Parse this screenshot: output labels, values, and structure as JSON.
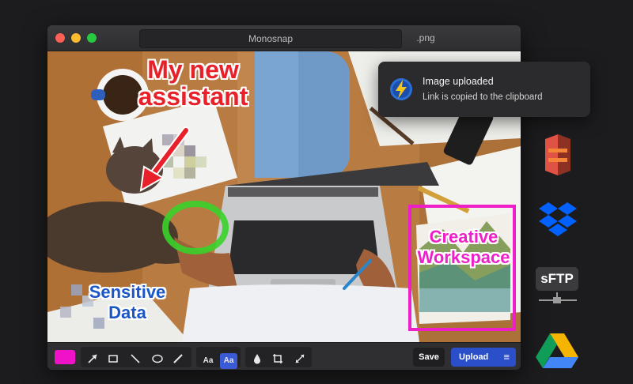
{
  "window": {
    "title": "Monosnap",
    "extension": ".png"
  },
  "annotations": {
    "red_text_line1": "My new",
    "red_text_line2": "assistant",
    "blue_text_line1": "Sensitive",
    "blue_text_line2": "Data",
    "pink_text_line1": "Creative",
    "pink_text_line2": "Workspace"
  },
  "toolbar": {
    "active_color": "#f012c8",
    "text_tool_label": "Aa",
    "text_tool_bg_label": "Aa",
    "save_label": "Save",
    "upload_label": "Upload"
  },
  "notification": {
    "title": "Image uploaded",
    "body": "Link is copied to the clipboard"
  },
  "services": {
    "sftp_label": "sFTP",
    "colors": {
      "amazon_s3": "#e05243",
      "dropbox": "#0061fe",
      "sftp": "#3b3b3d",
      "google_drive": [
        "#0f9d58",
        "#f4b400",
        "#4285f4"
      ]
    }
  },
  "colors": {
    "red_annotation": "#e8202a",
    "blue_annotation": "#1b56c6",
    "pink_annotation": "#ee1fc8",
    "green_annotation": "#39d12a",
    "upload_button": "#2b4fc9"
  }
}
